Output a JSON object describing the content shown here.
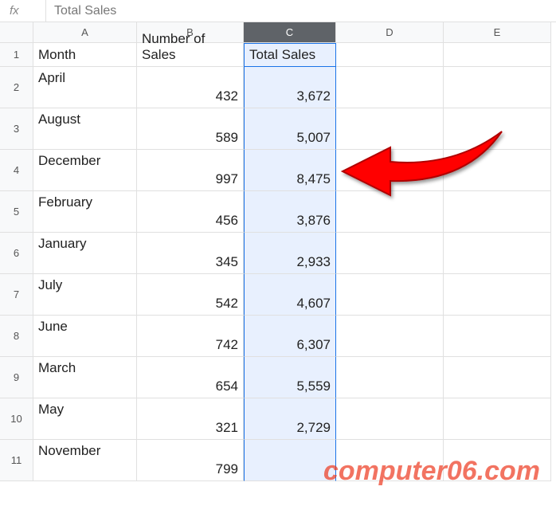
{
  "formula_bar": {
    "fx_label": "fx",
    "value": "Total Sales"
  },
  "columns": [
    "A",
    "B",
    "C",
    "D",
    "E"
  ],
  "selected_column": "C",
  "row_numbers": [
    "1",
    "2",
    "3",
    "4",
    "5",
    "6",
    "7",
    "8",
    "9",
    "10",
    "11"
  ],
  "headers": {
    "a": "Month",
    "b": "Number of Sales",
    "c": "Total Sales"
  },
  "rows": [
    {
      "month": "April",
      "sales": "432",
      "total": "3,672"
    },
    {
      "month": "August",
      "sales": "589",
      "total": "5,007"
    },
    {
      "month": "December",
      "sales": "997",
      "total": "8,475"
    },
    {
      "month": "February",
      "sales": "456",
      "total": "3,876"
    },
    {
      "month": "January",
      "sales": "345",
      "total": "2,933"
    },
    {
      "month": "July",
      "sales": "542",
      "total": "4,607"
    },
    {
      "month": "June",
      "sales": "742",
      "total": "6,307"
    },
    {
      "month": "March",
      "sales": "654",
      "total": "5,559"
    },
    {
      "month": "May",
      "sales": "321",
      "total": "2,729"
    },
    {
      "month": "November",
      "sales": "799",
      "total": ""
    }
  ],
  "watermark": "computer06.com",
  "chart_data": {
    "type": "table",
    "title": "Total Sales",
    "columns": [
      "Month",
      "Number of Sales",
      "Total Sales"
    ],
    "rows": [
      [
        "April",
        432,
        3672
      ],
      [
        "August",
        589,
        5007
      ],
      [
        "December",
        997,
        8475
      ],
      [
        "February",
        456,
        3876
      ],
      [
        "January",
        345,
        2933
      ],
      [
        "July",
        542,
        4607
      ],
      [
        "June",
        742,
        6307
      ],
      [
        "March",
        654,
        5559
      ],
      [
        "May",
        321,
        2729
      ],
      [
        "November",
        799,
        null
      ]
    ]
  }
}
